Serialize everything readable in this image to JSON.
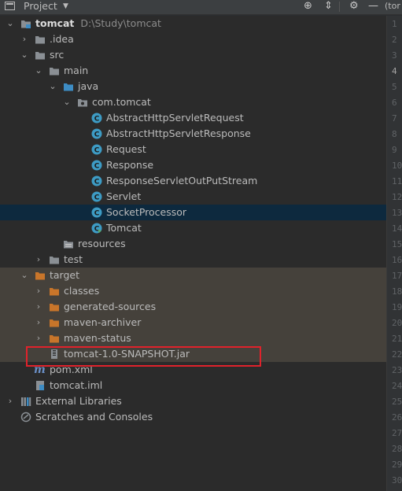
{
  "header": {
    "title": "Project",
    "editor_tab_stub": "(tor"
  },
  "tree": {
    "root": {
      "name": "tomcat",
      "path": "D:\\Study\\tomcat"
    },
    "idea": ".idea",
    "src": "src",
    "main": "main",
    "java": "java",
    "package": "com.tomcat",
    "classes": [
      "AbstractHttpServletRequest",
      "AbstractHttpServletResponse",
      "Request",
      "Response",
      "ResponseServletOutPutStream",
      "Servlet",
      "SocketProcessor",
      "Tomcat"
    ],
    "resources": "resources",
    "test": "test",
    "target": "target",
    "target_children": [
      "classes",
      "generated-sources",
      "maven-archiver",
      "maven-status"
    ],
    "jar": "tomcat-1.0-SNAPSHOT.jar",
    "pom": "pom.xml",
    "iml": "tomcat.iml",
    "external_libraries": "External Libraries",
    "scratches": "Scratches and Consoles"
  },
  "gutter": {
    "line_numbers": [
      "1",
      "2",
      "3",
      "4",
      "5",
      "6",
      "7",
      "8",
      "9",
      "10",
      "11",
      "12",
      "13",
      "14",
      "15",
      "16",
      "17",
      "18",
      "19",
      "20",
      "21",
      "22",
      "23",
      "24",
      "25",
      "26",
      "27",
      "28",
      "29",
      "30"
    ]
  },
  "colors": {
    "selected_row": "#0d293e",
    "excluded_row": "#45413b",
    "folder_orange": "#c8752a",
    "folder_gray": "#8a8f94",
    "class_icon": "#3d9bc4",
    "highlight_box": "#e0222b"
  }
}
